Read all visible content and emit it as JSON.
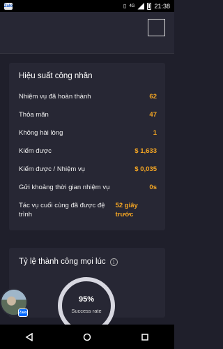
{
  "status_bar": {
    "app_badge": "Zalo",
    "network": "4G",
    "time": "21:38"
  },
  "performance": {
    "title": "Hiệu suất công nhân",
    "rows": [
      {
        "label": "Nhiệm vụ đã hoàn thành",
        "value": "62"
      },
      {
        "label": "Thỏa mãn",
        "value": "47"
      },
      {
        "label": "Không hài lòng",
        "value": "1"
      },
      {
        "label": "Kiếm được",
        "value": "$ 1,633"
      },
      {
        "label": "Kiếm được / Nhiệm vụ",
        "value": "$ 0,035"
      },
      {
        "label": "Gửi khoảng thời gian nhiệm vụ",
        "value": "0s"
      },
      {
        "label": "Tác vụ cuối cùng đã được đệ trình",
        "value": "52 giây trước"
      }
    ]
  },
  "success": {
    "title": "Tỷ lệ thành công mọi lúc",
    "percent": "95%",
    "label": "Success rate"
  },
  "chat_head": {
    "badge": "Zalo"
  },
  "colors": {
    "background": "#1f1f2b",
    "card": "#272734",
    "accent": "#f5a623"
  }
}
